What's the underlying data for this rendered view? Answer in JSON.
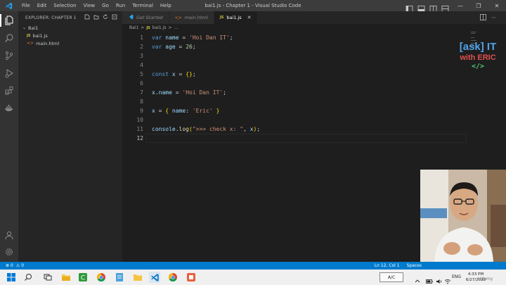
{
  "window": {
    "title": "bai1.js - Chapter 1 - Visual Studio Code",
    "menu": [
      "File",
      "Edit",
      "Selection",
      "View",
      "Go",
      "Run",
      "Terminal",
      "Help"
    ]
  },
  "sidebar": {
    "header": "EXPLORER: CHAPTER 1",
    "folder": "Bai1",
    "files": [
      "bai1.js",
      "main.html"
    ]
  },
  "tabs": [
    {
      "label": "Get Started",
      "active": false
    },
    {
      "label": "main.html",
      "active": false
    },
    {
      "label": "bai1.js",
      "active": true
    }
  ],
  "breadcrumb": {
    "folder": "Bai1",
    "sep": ">",
    "file": "bai1.js",
    "tail": "..."
  },
  "editor": {
    "line_numbers": [
      "1",
      "2",
      "3",
      "4",
      "5",
      "6",
      "7",
      "8",
      "9",
      "10",
      "11",
      "12"
    ],
    "current_line": "12",
    "lines": [
      [
        {
          "t": "var",
          "c": "kw"
        },
        {
          "t": " name ",
          "c": "var"
        },
        {
          "t": "= ",
          "c": "pun"
        },
        {
          "t": "'Hoi Dan IT'",
          "c": "str"
        },
        {
          "t": ";",
          "c": "pun"
        }
      ],
      [
        {
          "t": "var",
          "c": "kw"
        },
        {
          "t": " age ",
          "c": "var"
        },
        {
          "t": "= ",
          "c": "pun"
        },
        {
          "t": "26",
          "c": "num"
        },
        {
          "t": ";",
          "c": "pun"
        }
      ],
      [],
      [],
      [
        {
          "t": "const",
          "c": "kw"
        },
        {
          "t": " x ",
          "c": "var"
        },
        {
          "t": "= ",
          "c": "pun"
        },
        {
          "t": "{}",
          "c": "brc"
        },
        {
          "t": ";",
          "c": "pun"
        }
      ],
      [],
      [
        {
          "t": "x",
          "c": "var"
        },
        {
          "t": ".",
          "c": "pun"
        },
        {
          "t": "name",
          "c": "var"
        },
        {
          "t": " = ",
          "c": "pun"
        },
        {
          "t": "'Hoi Dan IT'",
          "c": "str"
        },
        {
          "t": ";",
          "c": "pun"
        }
      ],
      [],
      [
        {
          "t": "x",
          "c": "var"
        },
        {
          "t": " = ",
          "c": "pun"
        },
        {
          "t": "{",
          "c": "brc"
        },
        {
          "t": " name",
          "c": "var"
        },
        {
          "t": ": ",
          "c": "pun"
        },
        {
          "t": "'Eric'",
          "c": "str"
        },
        {
          "t": " ",
          "c": "pun"
        },
        {
          "t": "}",
          "c": "brc"
        }
      ],
      [],
      [
        {
          "t": "console",
          "c": "var"
        },
        {
          "t": ".",
          "c": "pun"
        },
        {
          "t": "log",
          "c": "fn"
        },
        {
          "t": "(",
          "c": "brc"
        },
        {
          "t": "\">>> check x: \"",
          "c": "str"
        },
        {
          "t": ", ",
          "c": "pun"
        },
        {
          "t": "x",
          "c": "var"
        },
        {
          "t": ")",
          "c": "brc"
        },
        {
          "t": ";",
          "c": "pun"
        }
      ],
      []
    ]
  },
  "overlay": {
    "line1": "[ask] IT",
    "line2": "with ERIC",
    "line3": "</>"
  },
  "status": {
    "errors": "0",
    "warnings": "0",
    "position": "Ln 12, Col 1",
    "spaces": "Spaces"
  },
  "taskbar": {
    "ac_label": "A/C",
    "language": "ENG",
    "time": "4:33 PM",
    "date": "6/27/2022",
    "watermark": "Udemy"
  },
  "colors": {
    "status_bar": "#007acc",
    "editor_bg": "#1e1e1e",
    "sidebar_bg": "#252526",
    "activity_bg": "#333333"
  },
  "icons": {
    "activity": [
      "explorer-icon",
      "search-icon",
      "source-control-icon",
      "run-debug-icon",
      "extensions-icon",
      "docker-icon",
      "account-icon",
      "settings-gear-icon"
    ],
    "taskbar": [
      "start-icon",
      "search-icon",
      "task-view-icon",
      "file-explorer-icon",
      "camtasia-icon",
      "chrome-icon",
      "notepad-icon",
      "folder-icon",
      "vscode-icon",
      "chrome-icon",
      "app-icon"
    ]
  }
}
